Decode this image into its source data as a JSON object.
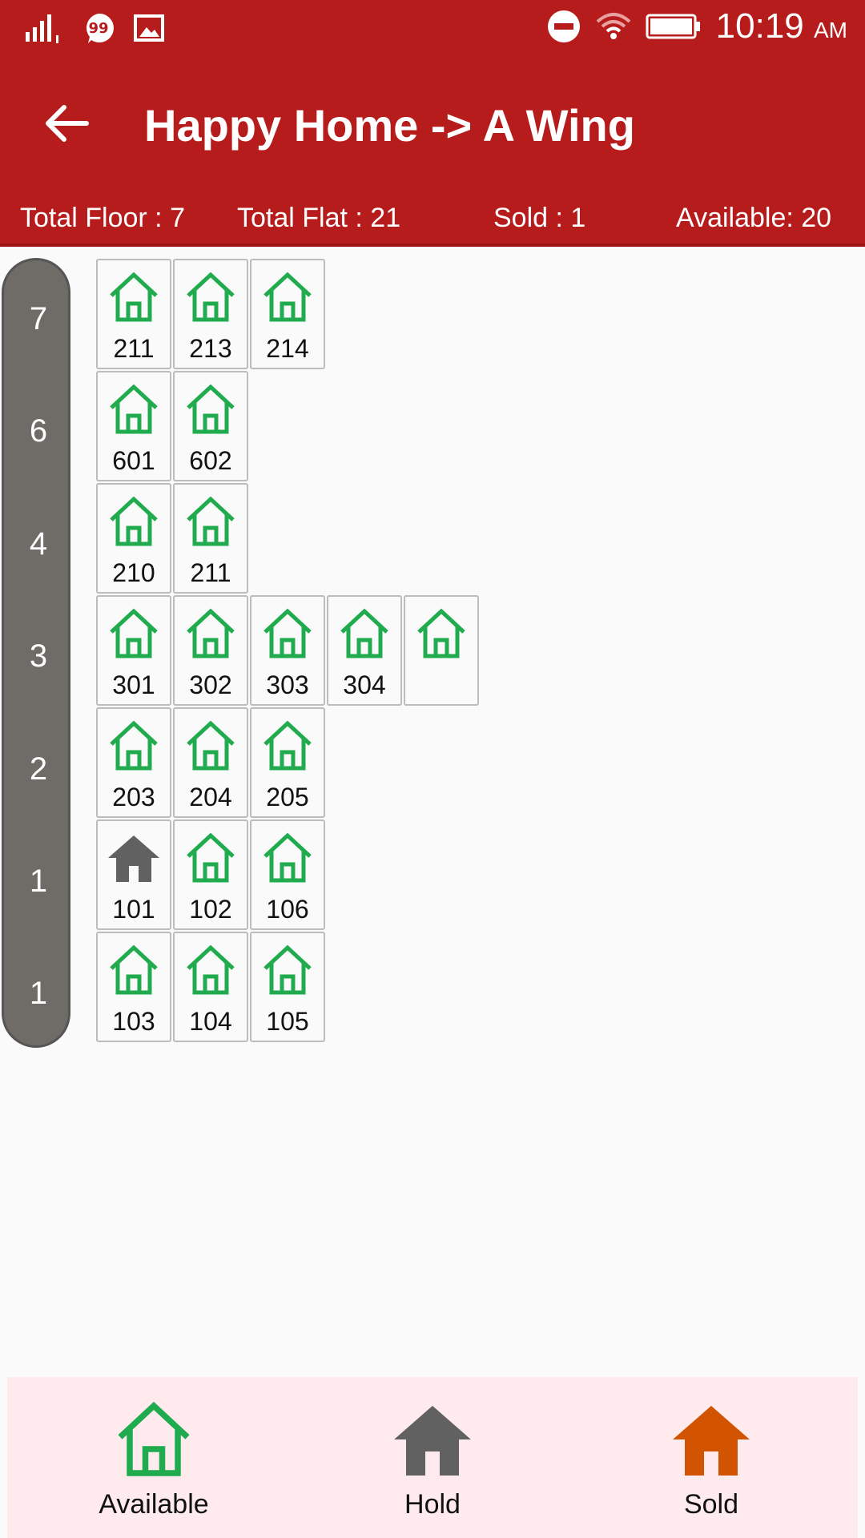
{
  "status_bar": {
    "time": "10:19",
    "ampm": "AM"
  },
  "app_bar": {
    "title": "Happy Home -> A Wing",
    "back_icon": "arrow-left-icon"
  },
  "summary": {
    "total_floor": "Total Floor : 7",
    "total_flat": "Total Flat : 21",
    "sold": "Sold : 1",
    "available": "Available: 20"
  },
  "floors": [
    {
      "label": "7",
      "flats": [
        {
          "num": "211",
          "status": "available"
        },
        {
          "num": "213",
          "status": "available"
        },
        {
          "num": "214",
          "status": "available"
        }
      ]
    },
    {
      "label": "6",
      "flats": [
        {
          "num": "601",
          "status": "available"
        },
        {
          "num": "602",
          "status": "available"
        }
      ]
    },
    {
      "label": "4",
      "flats": [
        {
          "num": "210",
          "status": "available"
        },
        {
          "num": "211",
          "status": "available"
        }
      ]
    },
    {
      "label": "3",
      "flats": [
        {
          "num": "301",
          "status": "available"
        },
        {
          "num": "302",
          "status": "available"
        },
        {
          "num": "303",
          "status": "available"
        },
        {
          "num": "304",
          "status": "available"
        },
        {
          "num": "",
          "status": "available"
        }
      ]
    },
    {
      "label": "2",
      "flats": [
        {
          "num": "203",
          "status": "available"
        },
        {
          "num": "204",
          "status": "available"
        },
        {
          "num": "205",
          "status": "available"
        }
      ]
    },
    {
      "label": "1",
      "flats": [
        {
          "num": "101",
          "status": "hold"
        },
        {
          "num": "102",
          "status": "available"
        },
        {
          "num": "106",
          "status": "available"
        }
      ]
    },
    {
      "label": "1",
      "flats": [
        {
          "num": "103",
          "status": "available"
        },
        {
          "num": "104",
          "status": "available"
        },
        {
          "num": "105",
          "status": "available"
        }
      ]
    }
  ],
  "legend": {
    "available": "Available",
    "hold": "Hold",
    "sold": "Sold"
  },
  "colors": {
    "primary": "#b71c1c",
    "available": "#1fab4e",
    "hold": "#616161",
    "sold": "#d35400",
    "legend_bg": "#ffebee"
  }
}
